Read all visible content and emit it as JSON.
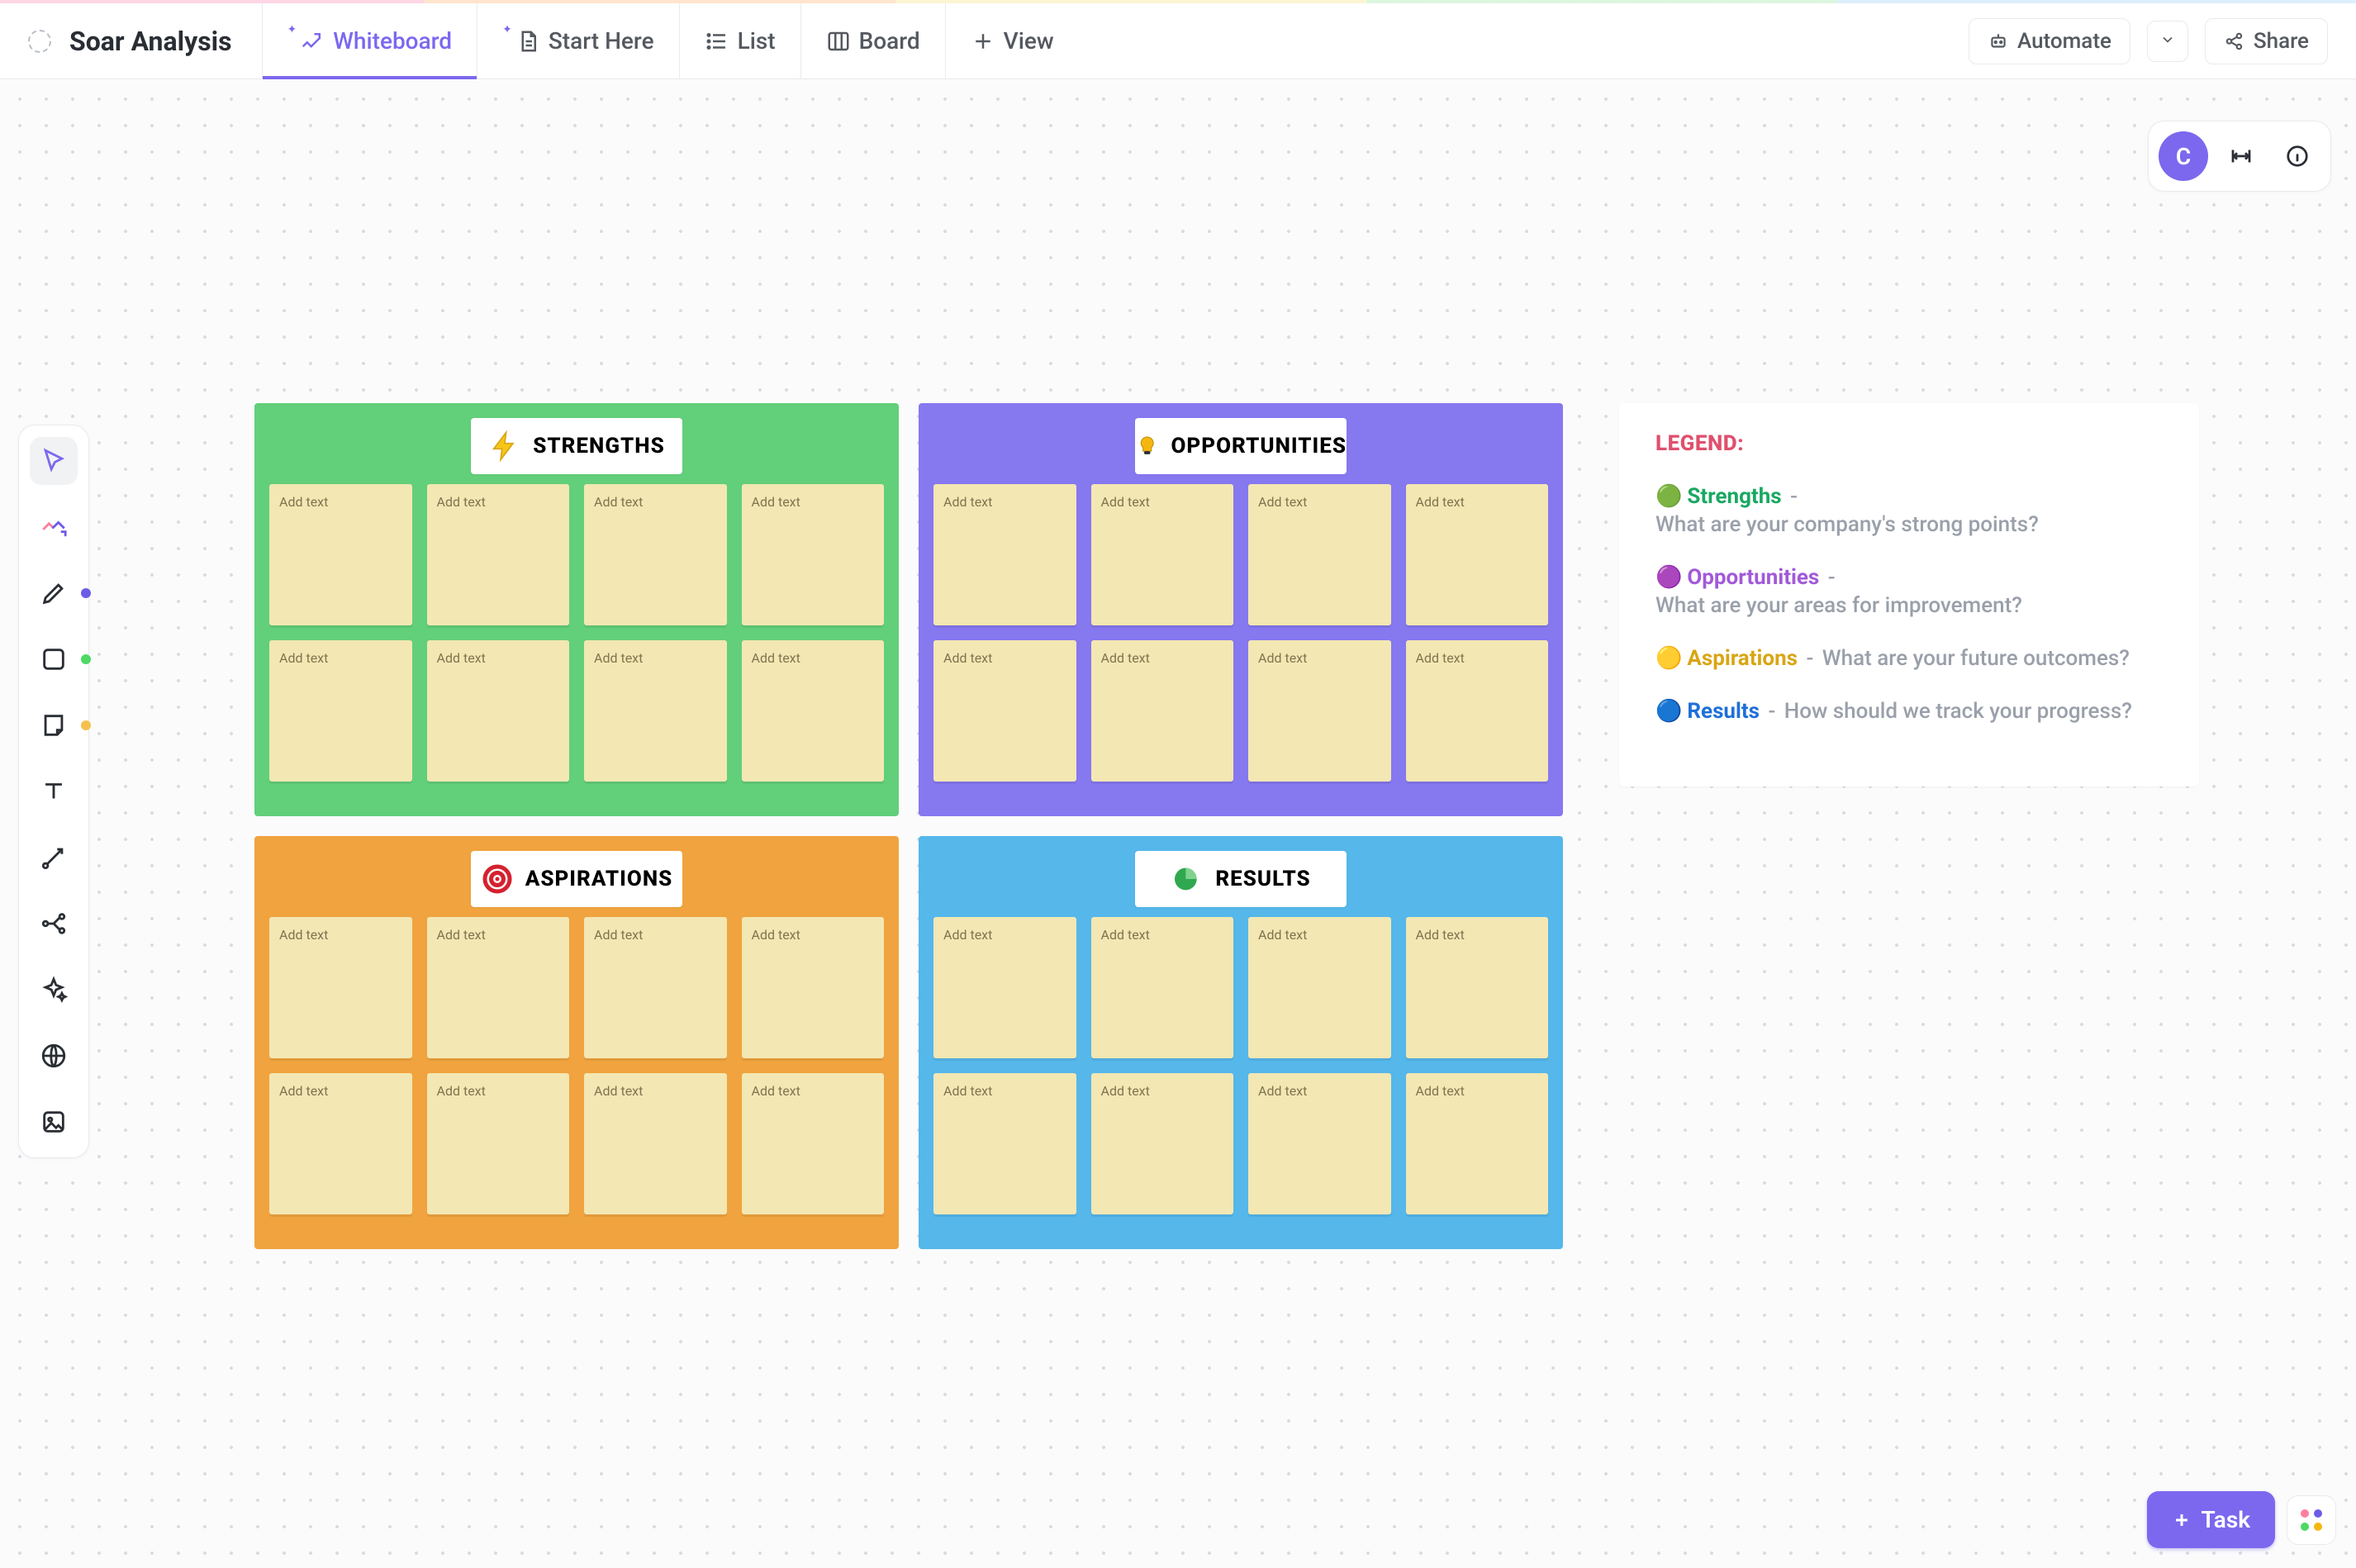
{
  "header": {
    "title": "Soar Analysis",
    "tabs": {
      "whiteboard": "Whiteboard",
      "start_here": "Start Here",
      "list": "List",
      "board": "Board",
      "view": "View"
    },
    "automate": "Automate",
    "share": "Share"
  },
  "avatar": {
    "initial": "C"
  },
  "toolbox": {
    "items": [
      "cursor",
      "trend",
      "pen",
      "shape",
      "sticky",
      "text",
      "connector",
      "branch",
      "ai",
      "web",
      "image"
    ]
  },
  "soar": {
    "sticky_placeholder": "Add text",
    "panels": {
      "strengths": {
        "label": "STRENGTHS",
        "color": "green"
      },
      "opportunities": {
        "label": "OPPORTUNITIES",
        "color": "purple"
      },
      "aspirations": {
        "label": "ASPIRATIONS",
        "color": "orange"
      },
      "results": {
        "label": "RESULTS",
        "color": "blue"
      }
    }
  },
  "legend": {
    "title": "LEGEND:",
    "items": {
      "strengths": {
        "emoji": "🟢",
        "term": "Strengths",
        "desc": "What are your company's strong points?"
      },
      "opportunities": {
        "emoji": "🟣",
        "term": "Opportunities",
        "desc": "What are your areas for improvement?"
      },
      "aspirations": {
        "emoji": "🟡",
        "term": "Aspirations",
        "desc": "What are your future outcomes?"
      },
      "results": {
        "emoji": "🔵",
        "term": "Results",
        "desc": "How should we track your progress?"
      }
    }
  },
  "task_button": "Task"
}
